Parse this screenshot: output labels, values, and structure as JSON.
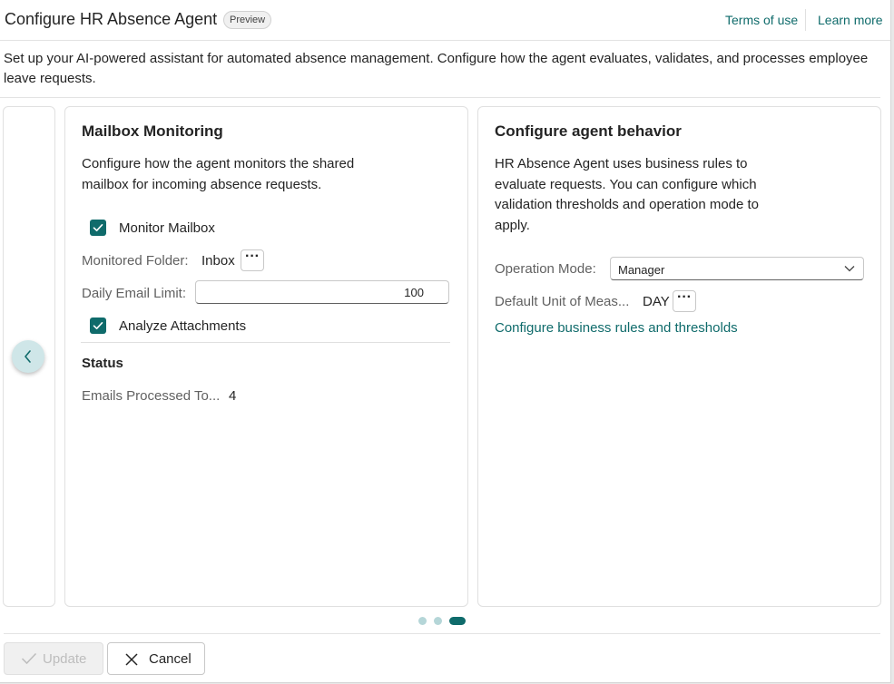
{
  "header": {
    "title": "Configure HR Absence Agent",
    "badge": "Preview",
    "terms_link": "Terms of use",
    "learn_more_link": "Learn more"
  },
  "description": "Set up your AI-powered assistant for automated absence management. Configure how the agent evaluates, validates, and processes employee leave requests.",
  "mailbox_card": {
    "title": "Mailbox Monitoring",
    "description": "Configure how the agent monitors the shared mailbox for incoming absence requests.",
    "monitor_mailbox": {
      "label": "Monitor Mailbox",
      "checked": true
    },
    "monitored_folder": {
      "label": "Monitored Folder:",
      "value": "Inbox"
    },
    "daily_email_limit": {
      "label": "Daily Email Limit:",
      "value": "100"
    },
    "analyze_attachments": {
      "label": "Analyze Attachments",
      "checked": true
    },
    "status": {
      "heading": "Status",
      "emails_processed_label": "Emails Processed To...",
      "emails_processed_value": "4"
    }
  },
  "behavior_card": {
    "title": "Configure agent behavior",
    "description": "HR Absence Agent uses business rules to evaluate requests. You can configure which validation thresholds and operation mode to apply.",
    "operation_mode": {
      "label": "Operation Mode:",
      "value": "Manager"
    },
    "default_unit": {
      "label": "Default Unit of Meas...",
      "value": "DAY"
    },
    "rules_link": "Configure business rules and thresholds"
  },
  "carousel": {
    "page_count": 3,
    "active_index": 2
  },
  "footer": {
    "update_label": "Update",
    "cancel_label": "Cancel"
  },
  "colors": {
    "accent": "#0f6b6b",
    "dot_inactive": "#b5d6d8",
    "nav_button": "#cfe6e8"
  },
  "icons": {
    "more": "more-horizontal-icon",
    "check": "checkmark-icon",
    "chevron_down": "chevron-down-icon",
    "chevron_left": "chevron-left-icon",
    "dismiss": "dismiss-icon"
  }
}
